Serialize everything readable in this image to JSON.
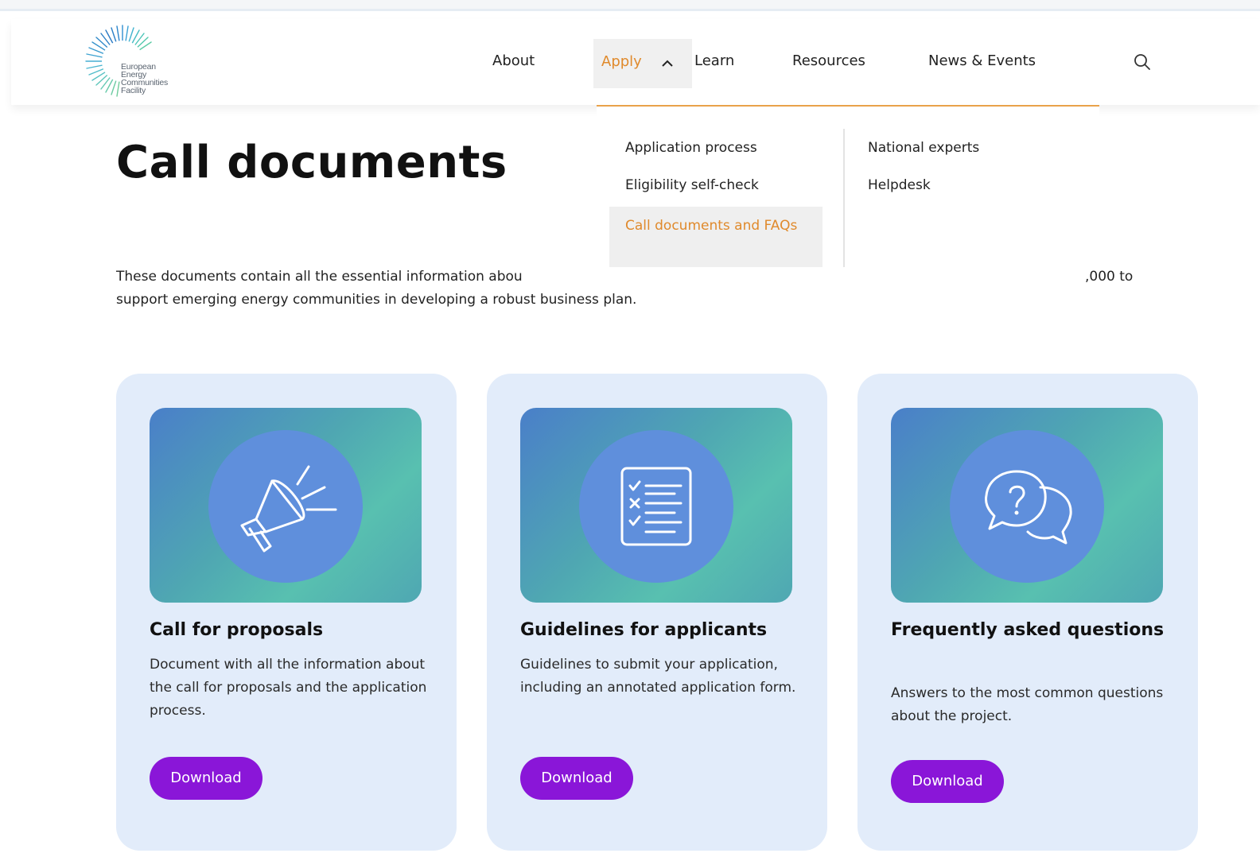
{
  "site": {
    "logo_text": "European\nEnergy\nCommunities\nFacility",
    "logo_icon": "sunburst-logo-icon"
  },
  "nav": {
    "items": [
      "About",
      "Apply",
      "Learn",
      "Resources",
      "News & Events"
    ],
    "active": "Apply",
    "active_color": "#e08a2c",
    "search_icon": "search-icon"
  },
  "dropdown": {
    "col1": [
      "Application process",
      "Eligibility self-check"
    ],
    "active_item": "Call documents and FAQs",
    "col2": [
      "National experts",
      "Helpdesk"
    ],
    "accent_color": "#e9a24a"
  },
  "page": {
    "title": "Call documents",
    "intro_line1_start": "These documents contain all the essential information abou",
    "intro_line1_end": ",000 to",
    "intro_line2": "support emerging energy communities in developing a robust business plan."
  },
  "cards": [
    {
      "icon": "megaphone-icon",
      "title": "Call for proposals",
      "description": "Document with all the information about the call for proposals and the application process.",
      "button": "Download"
    },
    {
      "icon": "checklist-icon",
      "title": "Guidelines for applicants",
      "description": "Guidelines to submit your application, including an annotated application form.",
      "button": "Download"
    },
    {
      "icon": "question-chat-icon",
      "title": "Frequently asked questions",
      "description": "Answers to the most common questions about the project.",
      "button": "Download"
    }
  ],
  "colors": {
    "button": "#8a16d8",
    "card_bg": "#e2ecfa",
    "icon_circle": "#5f8fdc"
  }
}
